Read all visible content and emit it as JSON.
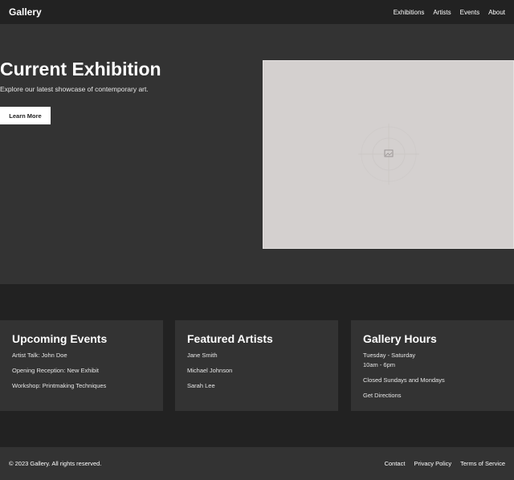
{
  "header": {
    "brand": "Gallery",
    "nav": [
      "Exhibitions",
      "Artists",
      "Events",
      "About"
    ]
  },
  "hero": {
    "title": "Current Exhibition",
    "subtitle": "Explore our latest showcase of contemporary art.",
    "button_label": "Learn More",
    "image_icon": "image-placeholder-icon"
  },
  "cards": [
    {
      "title": "Upcoming Events",
      "items": [
        "Artist Talk: John Doe",
        "Opening Reception: New Exhibit",
        "Workshop: Printmaking Techniques"
      ]
    },
    {
      "title": "Featured Artists",
      "items": [
        "Jane Smith",
        "Michael Johnson",
        "Sarah Lee"
      ]
    },
    {
      "title": "Gallery Hours",
      "items": [
        "Tuesday - Saturday",
        "10am - 6pm",
        "Closed Sundays and Mondays"
      ],
      "link": "Get Directions"
    }
  ],
  "footer": {
    "copyright": "© 2023 Gallery. All rights reserved.",
    "links": [
      "Contact",
      "Privacy Policy",
      "Terms of Service"
    ]
  },
  "colors": {
    "page_bg": "#222222",
    "panel_bg": "#333333",
    "image_bg": "#d4d0cf",
    "text": "#ffffff"
  }
}
